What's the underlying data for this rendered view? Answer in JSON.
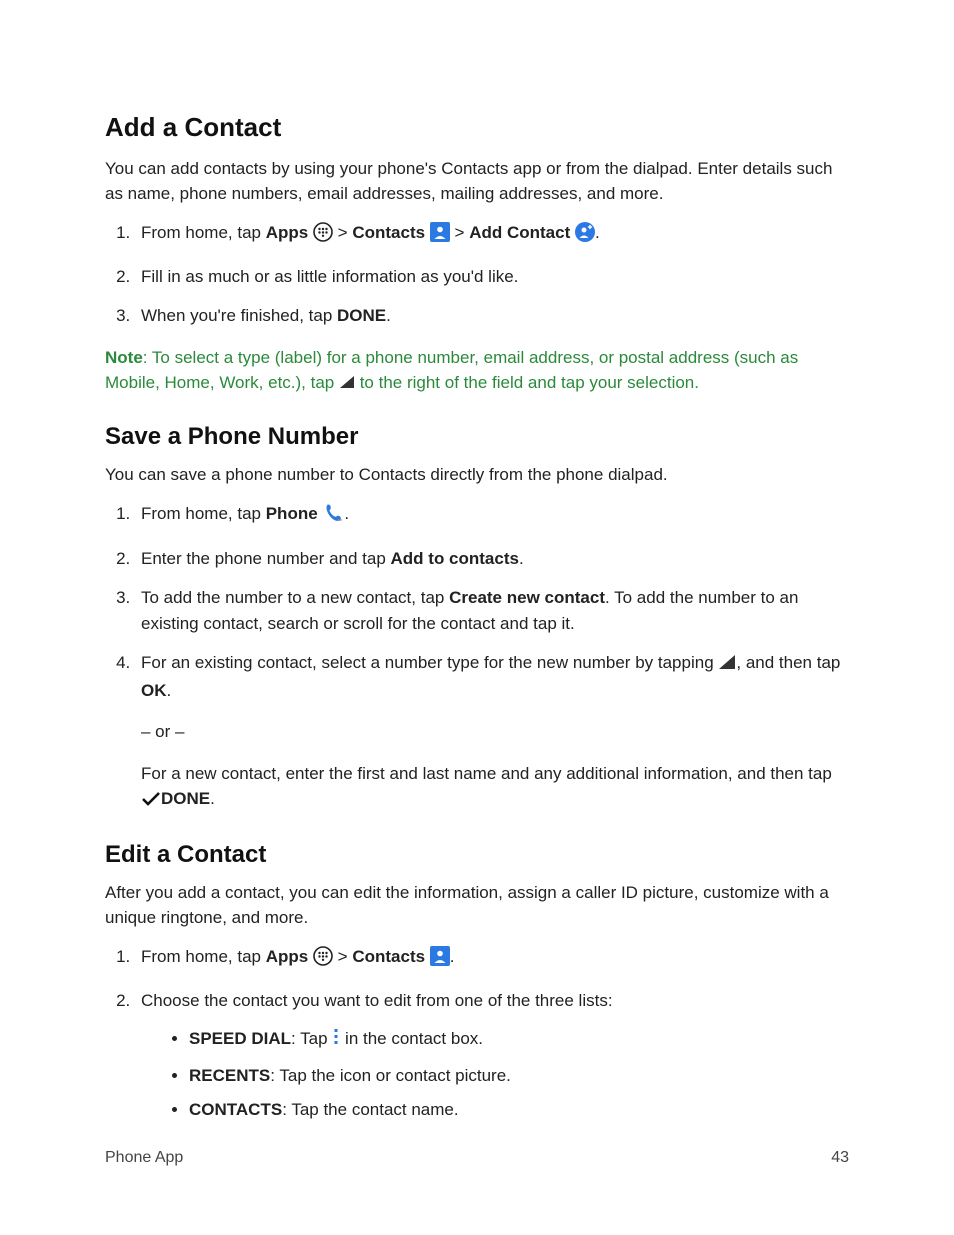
{
  "section_add": {
    "heading": "Add a Contact",
    "intro": "You can add contacts by using your phone's Contacts app or from the dialpad. Enter details such as name, phone numbers, email addresses, mailing addresses, and more.",
    "step1_a": "From home, tap ",
    "step1_apps": "Apps",
    "step1_b": " > ",
    "step1_contacts": "Contacts",
    "step1_c": " > ",
    "step1_addcontact": "Add  Contact",
    "step1_d": ".",
    "step2": "Fill in as much or as little information as you'd like.",
    "step3_a": "When you're finished, tap ",
    "step3_done": "DONE",
    "step3_b": ".",
    "note_bold": "Note",
    "note_a": ": To select a type (label) for a phone number, email address, or postal address (such as Mobile, Home, Work, etc.), tap ",
    "note_b": " to the right of the field and tap your selection."
  },
  "section_save": {
    "heading": "Save a Phone Number",
    "intro": "You can save a phone number to Contacts directly from the phone dialpad.",
    "step1_a": "From home, tap ",
    "step1_phone": "Phone",
    "step1_b": ".",
    "step2_a": "Enter the phone number and tap ",
    "step2_add": "Add to contacts",
    "step2_b": ".",
    "step3_a": "To add the number to a new contact, tap ",
    "step3_create": "Create new contact",
    "step3_b": ". To add the number to an existing contact, search or scroll for the contact and tap it.",
    "step4_a": "For an existing contact, select a number type for the new number by tapping ",
    "step4_b": ", and then tap ",
    "step4_ok": "OK",
    "step4_c": ".",
    "or": "– or –",
    "step4_d": "For a new contact, enter the first and last name and any additional information, and then tap ",
    "step4_done": "DONE",
    "step4_e": "."
  },
  "section_edit": {
    "heading": "Edit a Contact",
    "intro": "After you add a contact, you can edit the information, assign a caller ID picture, customize with a unique ringtone, and more.",
    "step1_a": "From home, tap ",
    "step1_apps": "Apps",
    "step1_b": " > ",
    "step1_contacts": "Contacts",
    "step1_c": ".",
    "step2": "Choose the contact you want to edit from one of the three lists:",
    "b1_label": "SPEED DIAL",
    "b1_a": ": Tap ",
    "b1_b": " in the contact box.",
    "b2_label": "RECENTS",
    "b2_a": ": Tap the icon or contact picture.",
    "b3_label": "CONTACTS",
    "b3_a": ": Tap the contact name."
  },
  "footer": {
    "left": "Phone App",
    "right": "43"
  }
}
